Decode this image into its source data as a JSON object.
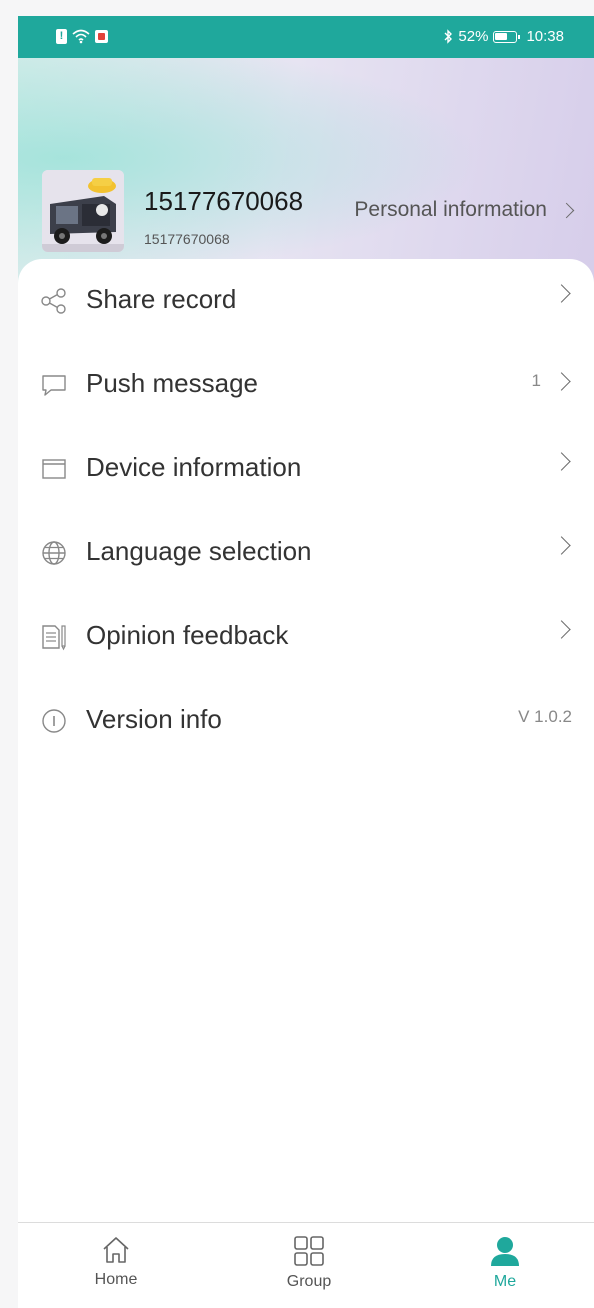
{
  "status_bar": {
    "battery": "52%",
    "time": "10:38"
  },
  "profile": {
    "name": "15177670068",
    "subtitle": "15177670068",
    "link_label": "Personal information"
  },
  "menu": [
    {
      "label": "Share record",
      "icon": "share-icon",
      "badge": ""
    },
    {
      "label": "Push message",
      "icon": "message-icon",
      "badge": "1"
    },
    {
      "label": "Device information",
      "icon": "device-icon",
      "badge": ""
    },
    {
      "label": "Language selection",
      "icon": "globe-icon",
      "badge": ""
    },
    {
      "label": "Opinion feedback",
      "icon": "feedback-icon",
      "badge": ""
    },
    {
      "label": "Version info",
      "icon": "info-icon",
      "value": "V 1.0.2"
    }
  ],
  "tabbar": {
    "tabs": [
      {
        "label": "Home",
        "icon": "home-icon"
      },
      {
        "label": "Group",
        "icon": "grid-icon"
      },
      {
        "label": "Me",
        "icon": "person-icon",
        "active": true
      }
    ]
  },
  "colors": {
    "accent": "#1fa89c",
    "text": "#333333",
    "muted": "#888888"
  }
}
